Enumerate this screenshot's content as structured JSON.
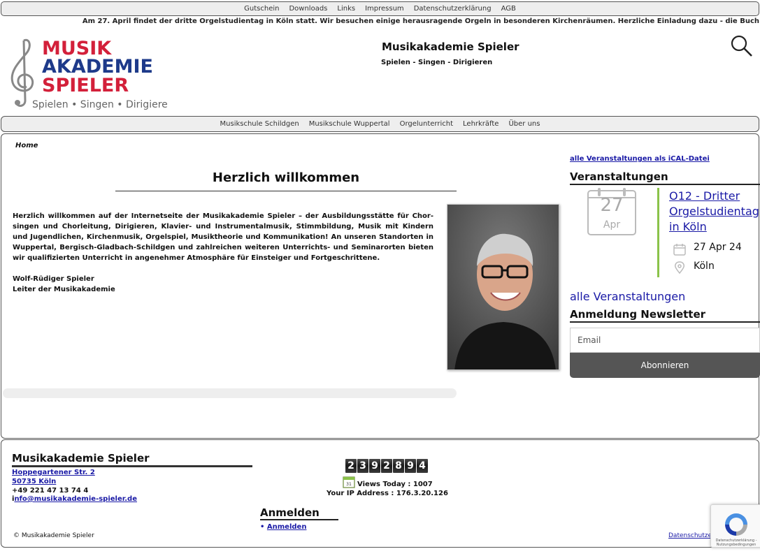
{
  "topnav": [
    "Gutschein",
    "Downloads",
    "Links",
    "Impressum",
    "Datenschutzerklärung",
    "AGB"
  ],
  "ticker": "Am 27. April findet der dritte Orgelstudientag in Köln statt. Wir besuchen einige herausragende Orgeln in besonderen Kirchenräumen. Herzliche Einladung dazu - die Buch",
  "header": {
    "logo_line1": "MUSIK",
    "logo_line2": "AKADEMIE",
    "logo_line3": "SPIELER",
    "logo_sub": "Spielen • Singen • Dirigieren",
    "title": "Musikakademie Spieler",
    "tagline": "Spielen - Singen - Dirigieren"
  },
  "mainnav": [
    "Musikschule Schildgen",
    "Musikschule Wuppertal",
    "Orgelunterricht",
    "Lehrkräfte",
    "Über uns"
  ],
  "breadcrumb": "Home",
  "welcome": {
    "heading": "Herzlich willkommen",
    "text": "Herzlich willkommen auf der Internetseite der Musikakademie Spieler – der Ausbildungsstätte für Chor- singen und Chorleitung, Dirigieren, Klavier- und Instrumentalmusik, Stimmbildung, Musik mit Kindern und Jugendlichen, Kirchenmusik, Orgelspiel, Musiktheorie und Kommunikation! An unseren Standorten in Wuppertal, Bergisch-Gladbach-Schildgen und zahlreichen weiteren Unterrichts- und Seminarorten bieten wir qualifizierten Unterricht in angenehmer Atmosphäre für Einsteiger und Fortgeschrittene.",
    "sig_name": "Wolf-Rüdiger Spieler",
    "sig_role": "Leiter der Musikakademie"
  },
  "sidebar": {
    "ical_link": "alle Veranstaltungen als iCAL-Datei",
    "events_heading": "Veranstaltungen",
    "event": {
      "day": "27",
      "month": "Apr",
      "title": "O12 - Dritter Orgelstudientag in Köln",
      "date": "27 Apr 24",
      "place": "Köln"
    },
    "all_events": "alle Veranstaltungen",
    "newsletter_heading": "Anmeldung Newsletter",
    "email_placeholder": "Email",
    "subscribe_label": "Abonnieren"
  },
  "footer": {
    "title": "Musikakademie Spieler",
    "street": "Hoppegartener Str. 2",
    "city": "50735 Köln",
    "phone": "+49 221 47 13 74 4",
    "email_prefix": "i",
    "email": "nfo@musikakademie-spieler.de",
    "counter_digits": [
      "2",
      "3",
      "9",
      "2",
      "8",
      "9",
      "4"
    ],
    "views_today": "Views Today : 1007",
    "ip": "Your IP Address : 176.3.20.126",
    "login_heading": "Anmelden",
    "login_bullet": "•",
    "login_link": "Anmelden",
    "copyright": "© Musikakademie Spieler",
    "privacy": "Datenschutze"
  },
  "recaptcha": {
    "text": "Datenschutzerklärung - Nutzungsbedingungen"
  },
  "colors": {
    "nav_bg": "#eeeeee",
    "logo_red": "#d3203a",
    "logo_blue": "#1e3a8a",
    "link": "#1a1aa6",
    "event_bar": "#8bc34a",
    "button": "#555555"
  }
}
